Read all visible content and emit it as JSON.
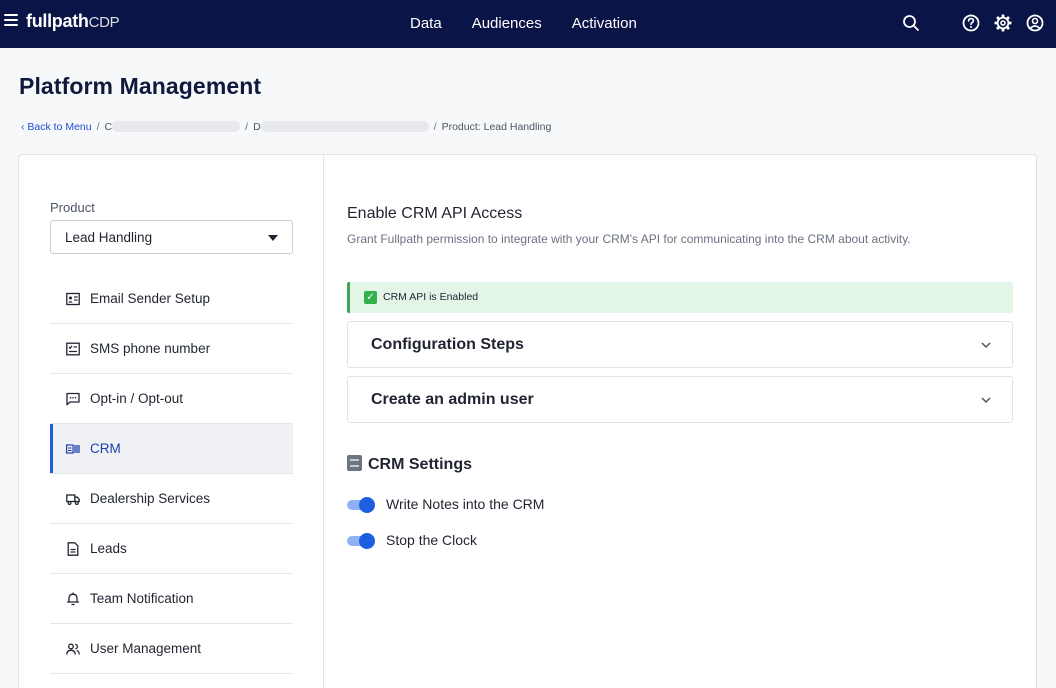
{
  "topbar": {
    "logo_brand": "fullpath",
    "logo_suffix": "CDP",
    "nav": [
      "Data",
      "Audiences",
      "Activation"
    ],
    "icons": [
      "menu-icon",
      "search-icon",
      "help-icon",
      "settings-icon",
      "account-icon"
    ]
  },
  "page": {
    "title": "Platform Management"
  },
  "breadcrumb": {
    "back": "‹ Back to Menu",
    "crumb1": "C",
    "crumb2": "D",
    "current": "Product: Lead Handling"
  },
  "sidebar": {
    "product_label": "Product",
    "product_value": "Lead Handling",
    "items": [
      {
        "label": "Email Sender Setup",
        "icon": "id-card-icon"
      },
      {
        "label": "SMS phone number",
        "icon": "sms-form-icon"
      },
      {
        "label": "Opt-in / Opt-out",
        "icon": "chat-bubble-icon"
      },
      {
        "label": "CRM",
        "icon": "crm-icon",
        "active": true
      },
      {
        "label": "Dealership Services",
        "icon": "truck-icon"
      },
      {
        "label": "Leads",
        "icon": "document-icon"
      },
      {
        "label": "Team Notification",
        "icon": "bell-icon"
      },
      {
        "label": "User Management",
        "icon": "users-icon"
      }
    ]
  },
  "main": {
    "section_title": "Enable CRM API Access",
    "section_desc": "Grant Fullpath permission to integrate with your CRM's API for communicating into the CRM about activity.",
    "alert_text": "CRM API is Enabled",
    "accordions": [
      "Configuration Steps",
      "Create an admin user"
    ],
    "settings_title": "CRM Settings",
    "toggles": [
      {
        "label": "Write Notes into the CRM",
        "on": true
      },
      {
        "label": "Stop the Clock",
        "on": true
      }
    ]
  },
  "colors": {
    "nav_bg": "#0b1446",
    "accent": "#1d5fe0",
    "success_bg": "#e3f5e6",
    "success": "#32b14a"
  }
}
